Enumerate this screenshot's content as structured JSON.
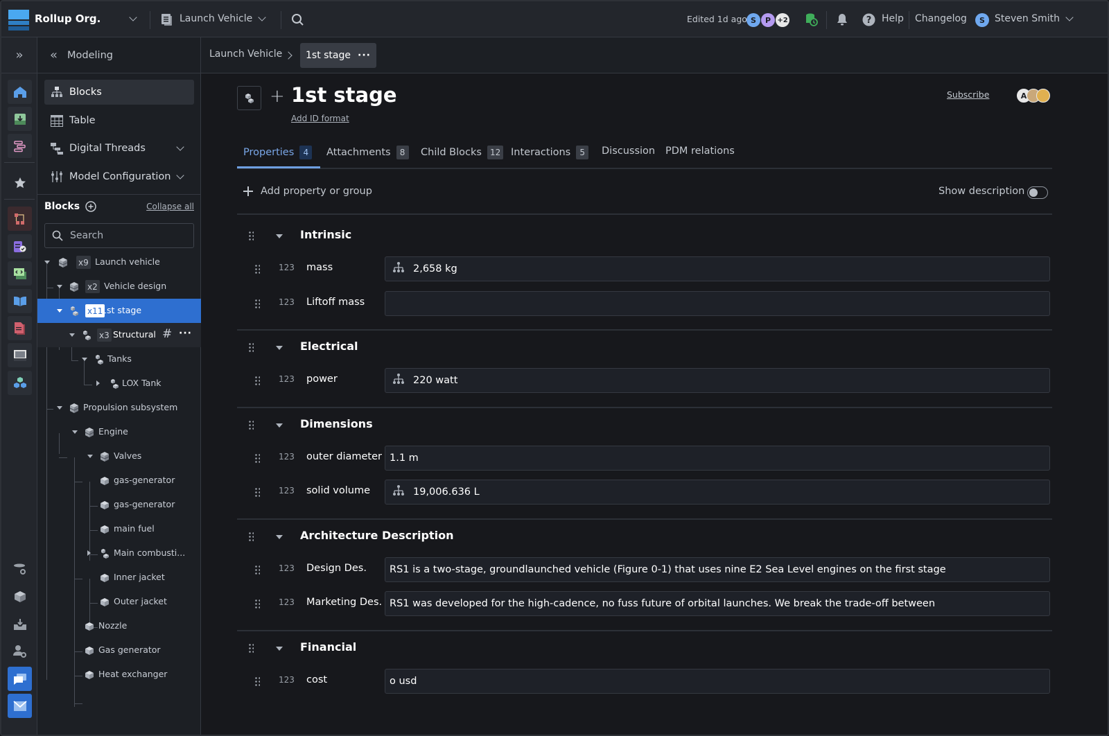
{
  "topbar": {
    "org_name": "Rollup Org.",
    "workspace": "Launch Vehicle",
    "edited": "Edited 1d ago",
    "collaborators": [
      {
        "initial": "S",
        "color": "#6fa8ef"
      },
      {
        "initial": "P",
        "color": "#b49af0"
      },
      {
        "initial": "+2",
        "color": "#e8e8e8"
      }
    ],
    "help_label": "Help",
    "changelog_label": "Changelog",
    "user_initial": "S",
    "user_name": "Steven Smith"
  },
  "sidebar": {
    "section_title": "Modeling",
    "nav": [
      {
        "label": "Blocks",
        "icon": "hierarchy-icon",
        "active": true
      },
      {
        "label": "Table",
        "icon": "table-icon"
      },
      {
        "label": "Digital Threads",
        "icon": "threads-icon",
        "expandable": true
      },
      {
        "label": "Model Configuration",
        "icon": "sliders-icon",
        "expandable": true
      }
    ],
    "blocks_header": "Blocks",
    "collapse_all": "Collapse all",
    "search_placeholder": "Search",
    "tree": [
      {
        "label": "Launch vehicle",
        "badge": "x9"
      },
      {
        "label": "Vehicle design",
        "badge": "x2"
      },
      {
        "label": "1st stage",
        "badge": "x11",
        "selected": true
      },
      {
        "label": "Structural",
        "badge": "x3"
      },
      {
        "label": "Tanks"
      },
      {
        "label": "LOX Tank"
      },
      {
        "label": "Propulsion subsystem"
      },
      {
        "label": "Engine"
      },
      {
        "label": "Valves"
      },
      {
        "label": "gas-generator"
      },
      {
        "label": "gas-generator"
      },
      {
        "label": "main fuel"
      },
      {
        "label": "Main combusti..."
      },
      {
        "label": "Inner jacket"
      },
      {
        "label": "Outer jacket"
      },
      {
        "label": "Nozzle"
      },
      {
        "label": "Gas generator"
      },
      {
        "label": "Heat exchanger"
      }
    ]
  },
  "breadcrumb": {
    "parent": "Launch Vehicle",
    "current": "1st stage"
  },
  "block": {
    "title": "1st stage",
    "add_id_format": "Add ID format",
    "subscribe": "Subscribe",
    "watchers": [
      "A",
      "",
      ""
    ]
  },
  "tabs": [
    {
      "label": "Properties",
      "count": "4",
      "active": true
    },
    {
      "label": "Attachments",
      "count": "8"
    },
    {
      "label": "Child Blocks",
      "count": "12"
    },
    {
      "label": "Interactions",
      "count": "5"
    },
    {
      "label": "Discussion"
    },
    {
      "label": "PDM relations"
    }
  ],
  "properties": {
    "add_label": "Add property or group",
    "show_description": "Show description",
    "show_description_on": false,
    "groups": [
      {
        "title": "Intrinsic",
        "rows": [
          {
            "type": "123",
            "name": "mass",
            "value": "2,658 kg",
            "rollup": true
          },
          {
            "type": "123",
            "name": "Liftoff mass",
            "value": ""
          }
        ]
      },
      {
        "title": "Electrical",
        "rows": [
          {
            "type": "123",
            "name": "power",
            "value": "220 watt",
            "rollup": true
          }
        ]
      },
      {
        "title": "Dimensions",
        "rows": [
          {
            "type": "123",
            "name": "outer diameter",
            "value": "1.1 m"
          },
          {
            "type": "123",
            "name": "solid volume",
            "value": "19,006.636 L",
            "rollup": true
          }
        ]
      },
      {
        "title": "Architecture Description",
        "rows": [
          {
            "type": "123",
            "name": "Design Des.",
            "value": "RS1 is a two-stage, groundlaunched vehicle (Figure 0-1) that uses nine E2 Sea Level engines on the first stage"
          },
          {
            "type": "123",
            "name": "Marketing Des.",
            "value": "RS1 was developed for the high-cadence, no fuss future of orbital launches. We break the trade-off between"
          }
        ]
      },
      {
        "title": "Financial",
        "rows": [
          {
            "type": "123",
            "name": "cost",
            "value": "o usd"
          }
        ]
      }
    ]
  }
}
